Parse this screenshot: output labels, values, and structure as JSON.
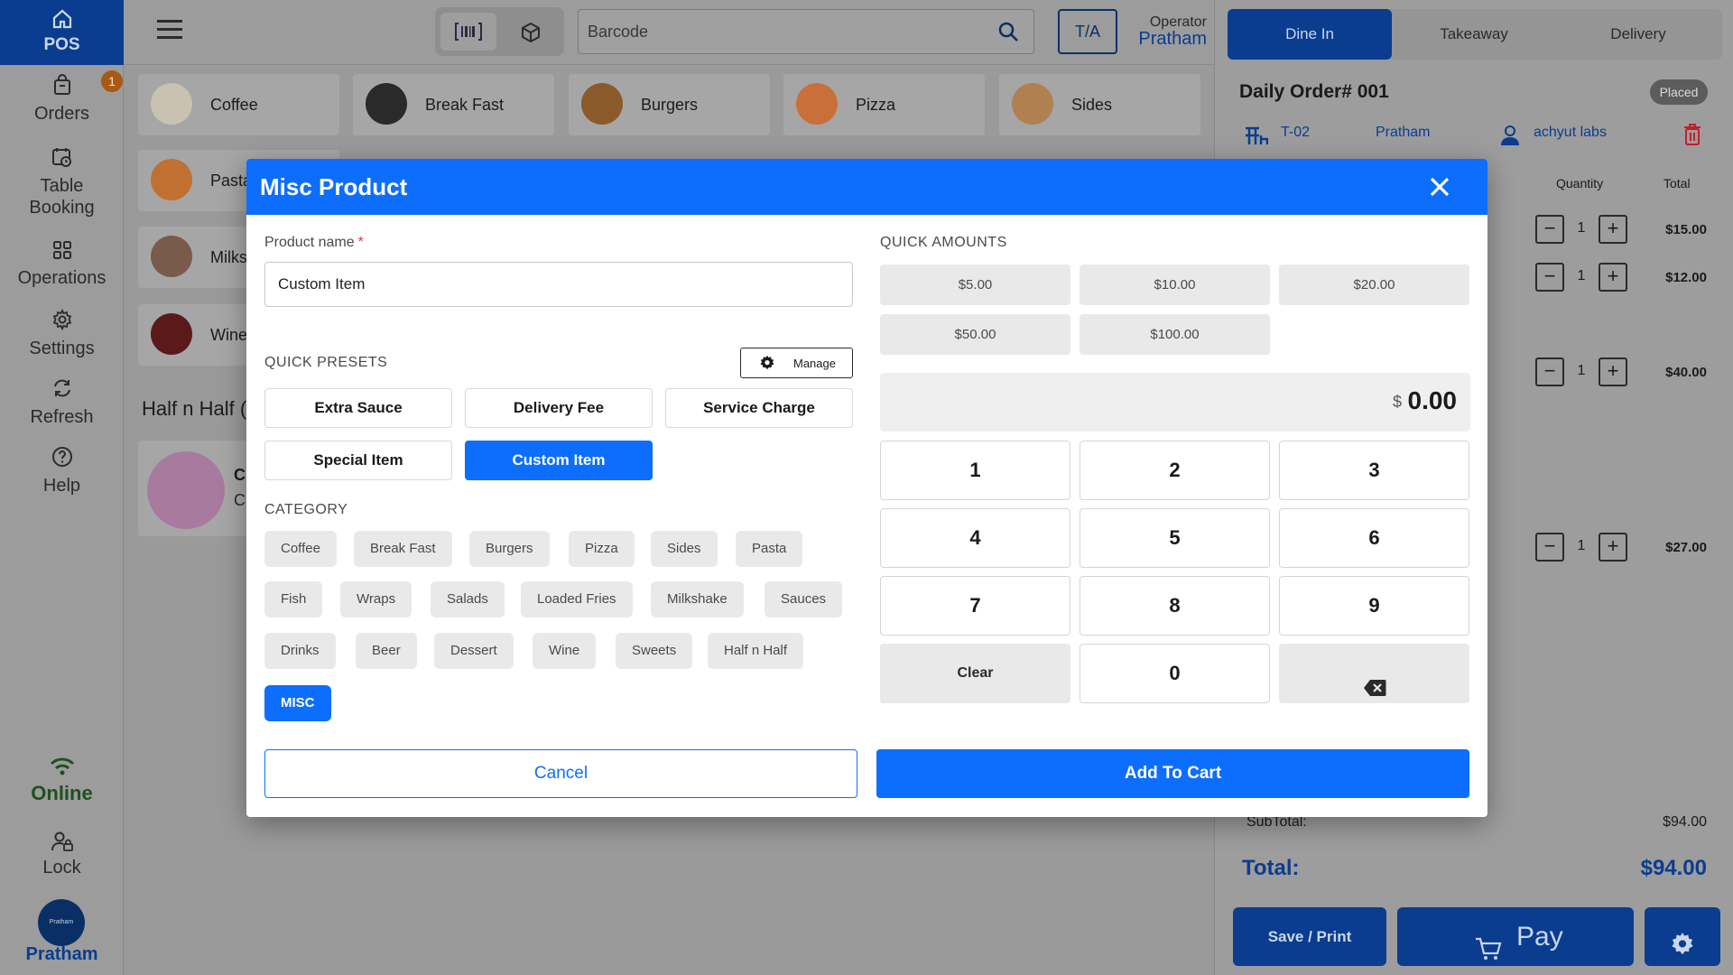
{
  "sidebar": {
    "pos_label": "POS",
    "items": [
      {
        "label": "Orders",
        "icon": "bag-icon"
      },
      {
        "label": "Table Booking",
        "icon": "clock-icon"
      },
      {
        "label": "Operations",
        "icon": "grid-icon"
      },
      {
        "label": "Settings",
        "icon": "gear-icon"
      },
      {
        "label": "Refresh",
        "icon": "refresh-icon"
      },
      {
        "label": "Help",
        "icon": "help-icon"
      }
    ],
    "orders_badge": "1",
    "status": "Online",
    "lock_label": "Lock",
    "user_name": "Pratham",
    "avatar_text": "Pratham"
  },
  "topbar": {
    "search_placeholder": "Barcode",
    "ta_label": "T/A",
    "operator_label": "Operator",
    "operator_name": "Pratham"
  },
  "categories": [
    {
      "name": "Coffee",
      "color": "#c9c2b2"
    },
    {
      "name": "Break Fast",
      "color": "#2a2a2a"
    },
    {
      "name": "Burgers",
      "color": "#8a5a2a"
    },
    {
      "name": "Pizza",
      "color": "#c9703a"
    },
    {
      "name": "Sides",
      "color": "#b08050"
    },
    {
      "name": "Pasta",
      "color": "#c07030"
    },
    {
      "name": "Milks",
      "color": "#7a5a4a"
    },
    {
      "name": "Wine",
      "color": "#5a1a1a"
    }
  ],
  "halfnhalf_title": "Half n Half (",
  "hnh_card": {
    "line1": "C",
    "line2": "C"
  },
  "order": {
    "tabs": [
      "Dine In",
      "Takeaway",
      "Delivery"
    ],
    "title": "Daily Order# 001",
    "status": "Placed",
    "table": "T-02",
    "server": "Pratham",
    "customer": "achyut labs",
    "col_quantity": "Quantity",
    "col_total": "Total",
    "lines": [
      {
        "qty": "1",
        "total": "$15.00"
      },
      {
        "qty": "1",
        "total": "$12.00"
      },
      {
        "qty": "1",
        "total": "$40.00"
      },
      {
        "qty": "1",
        "total": "$27.00"
      }
    ],
    "subtotal_label": "SubTotal:",
    "subtotal_value": "$94.00",
    "total_label": "Total:",
    "total_value": "$94.00",
    "save_label": "Save / Print",
    "pay_label": "Pay"
  },
  "modal": {
    "title": "Misc Product",
    "product_name_label": "Product name",
    "required_mark": "*",
    "product_name_value": "Custom Item",
    "quick_presets_label": "QUICK PRESETS",
    "manage_label": "Manage",
    "presets": [
      "Extra Sauce",
      "Delivery Fee",
      "Service Charge",
      "Special Item",
      "Custom Item"
    ],
    "active_preset": "Custom Item",
    "category_label": "CATEGORY",
    "category_chips": [
      "Coffee",
      "Break Fast",
      "Burgers",
      "Pizza",
      "Sides",
      "Pasta",
      "Fish",
      "Wraps",
      "Salads",
      "Loaded Fries",
      "Milkshake",
      "Sauces",
      "Drinks",
      "Beer",
      "Dessert",
      "Wine",
      "Sweets",
      "Half n Half",
      "MISC"
    ],
    "active_category": "MISC",
    "quick_amounts_label": "QUICK AMOUNTS",
    "quick_amounts": [
      "$5.00",
      "$10.00",
      "$20.00",
      "$50.00",
      "$100.00"
    ],
    "currency_symbol": "$",
    "amount_value": "0.00",
    "keys": [
      "1",
      "2",
      "3",
      "4",
      "5",
      "6",
      "7",
      "8",
      "9",
      "Clear",
      "0"
    ],
    "cancel_label": "Cancel",
    "add_label": "Add To Cart"
  },
  "colors": {
    "primary": "#0d6efd",
    "navy": "#0a3d8f",
    "overlay": "#9c9c9c"
  }
}
